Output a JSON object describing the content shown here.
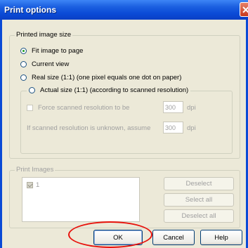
{
  "window": {
    "title": "Print options",
    "close_glyph": "✕"
  },
  "printed_image_size": {
    "legend": "Printed image size",
    "options": [
      {
        "label": "Fit image to page",
        "checked": true
      },
      {
        "label": "Current view",
        "checked": false
      },
      {
        "label": "Real size (1:1) (one pixel equals one dot on paper)",
        "checked": false
      }
    ],
    "actual_size": {
      "label": "Actual size (1:1) (according to scanned resolution)",
      "force_label": "Force scanned resolution to be",
      "force_value": "300",
      "force_unit": "dpi",
      "unknown_label": "If scanned resolution is unknown, assume",
      "unknown_value": "300",
      "unknown_unit": "dpi"
    }
  },
  "print_images": {
    "legend": "Print Images",
    "items": [
      {
        "label": "1",
        "checked": true
      }
    ],
    "deselect_label": "Deselect",
    "select_all_label": "Select all",
    "deselect_all_label": "Deselect all"
  },
  "footer": {
    "ok_label": "OK",
    "cancel_label": "Cancel",
    "help_label": "Help"
  },
  "colors": {
    "title_bar": "#0a4ad6",
    "annotation": "#e8120c"
  }
}
